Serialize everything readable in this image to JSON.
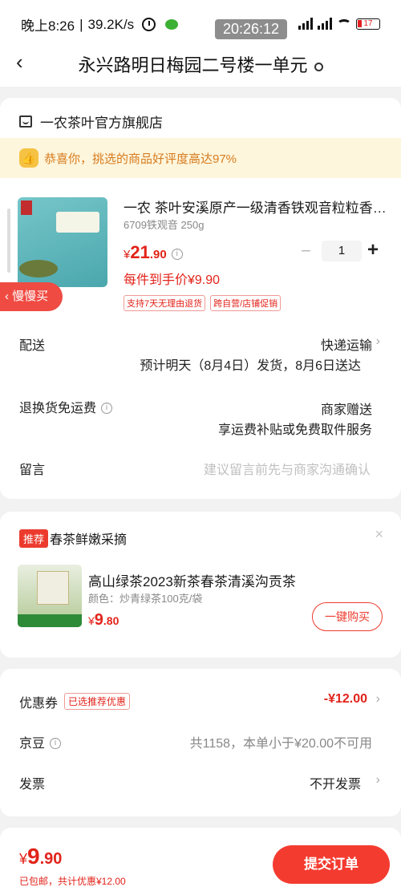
{
  "status_bar": {
    "time": "晚上8:26",
    "speed": "39.2K/s",
    "clock_overlay": "20:26:12",
    "battery": "17",
    "icons": [
      "alarm-icon",
      "wechat-icon",
      "signal-icon",
      "wifi-icon",
      "battery-icon"
    ]
  },
  "header": {
    "back_icon": "‹",
    "address": "永兴路明日梅园二号楼一单元"
  },
  "store": {
    "name": "一农茶叶官方旗舰店",
    "banner_icon": "👍",
    "banner_text": "恭喜你，挑选的商品好评度高达97%"
  },
  "product": {
    "title": "一农 茶叶安溪原产一级清香铁观音粒粒香…",
    "spec": "6709铁观音 250g",
    "price_currency": "¥",
    "price_int": "21",
    "price_dec": ".90",
    "info_icon": "i",
    "quantity": "1",
    "minus": "−",
    "plus": "+",
    "unit_price": "每件到手价¥9.90",
    "tags": [
      "支持7天无理由退货",
      "跨自营/店铺促销"
    ],
    "slow_buy": "慢慢买"
  },
  "delivery": {
    "label": "配送",
    "method": "快递运输",
    "estimate": "预计明天（8月4日）发货，8月6日送达"
  },
  "return_shipping": {
    "label": "退换货免运费",
    "value1": "商家赠送",
    "value2": "享运费补贴或免费取件服务"
  },
  "message": {
    "label": "留言",
    "placeholder": "建议留言前先与商家沟通确认"
  },
  "recommend": {
    "badge": "推荐",
    "title": "春茶鲜嫩采摘",
    "close": "×",
    "item_name": "高山绿茶2023新茶春茶清溪沟贡茶",
    "item_spec": "颜色：炒青绿茶100克/袋",
    "price_currency": "¥",
    "price_int": "9",
    "price_dec": ".80",
    "buy_button": "一键购买"
  },
  "coupon": {
    "label": "优惠券",
    "tag": "已选推荐优惠",
    "value": "-¥12.00"
  },
  "jingdou": {
    "label": "京豆",
    "value": "共1158，本单小于¥20.00不可用"
  },
  "invoice": {
    "label": "发票",
    "value": "不开发票"
  },
  "bottom": {
    "currency": "¥",
    "total_int": "9",
    "total_dec": ".90",
    "sub": "已包邮，共计优惠¥12.00",
    "submit": "提交订单"
  },
  "chevron": "›"
}
